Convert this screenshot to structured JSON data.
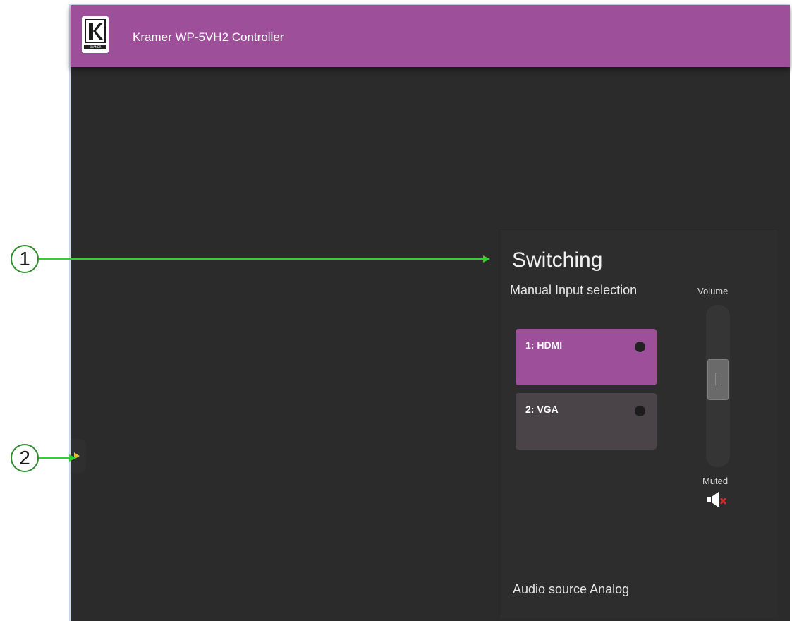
{
  "header": {
    "title": "Kramer WP-5VH2 Controller",
    "logo_text": "KRAMER"
  },
  "panel": {
    "section_title": "Switching",
    "manual_label": "Manual Input selection",
    "inputs": [
      {
        "label": "1: HDMI",
        "selected": true
      },
      {
        "label": "2: VGA",
        "selected": false
      }
    ],
    "volume_label": "Volume",
    "volume_level": 0.55,
    "muted_label": "Muted",
    "audio_source": "Audio source Analog"
  },
  "callouts": [
    "1",
    "2"
  ],
  "colors": {
    "accent": "#9e4f9a",
    "background": "#2b2b2b",
    "callout_green": "#2ed12e",
    "handle_arrow": "#e0c020"
  }
}
